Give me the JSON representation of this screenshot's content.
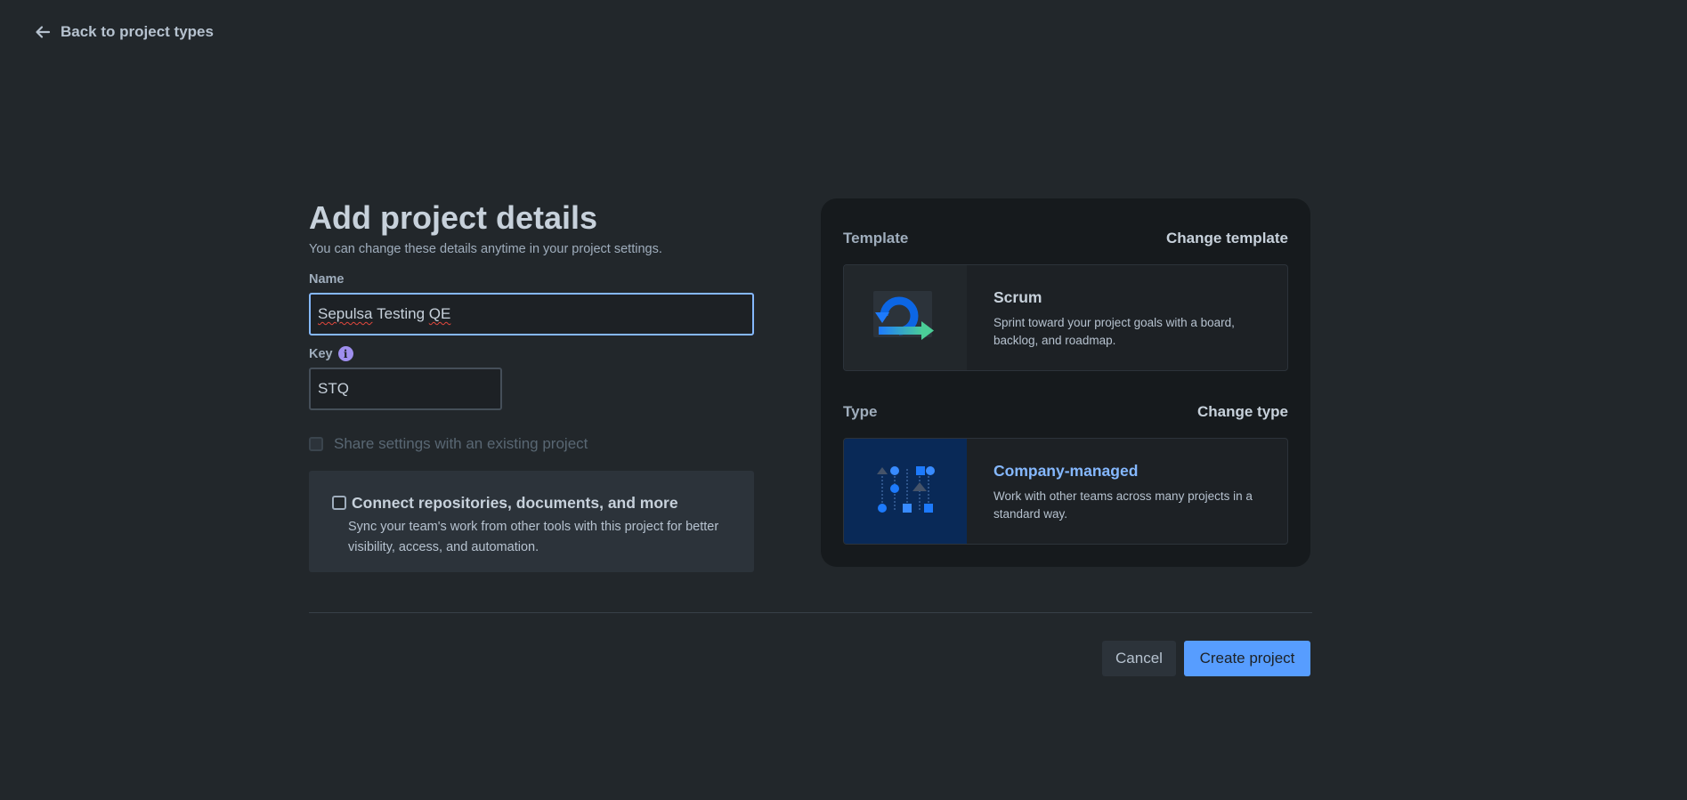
{
  "nav": {
    "back_label": "Back to project types"
  },
  "form": {
    "title": "Add project details",
    "subtitle": "You can change these details anytime in your project settings.",
    "name_label": "Name",
    "name_value_word1": "Sepulsa",
    "name_value_word2": "Testing",
    "name_value_word3": "QE",
    "key_label": "Key",
    "key_info_icon": "i",
    "key_value": "STQ",
    "share_settings_label": "Share settings with an existing project",
    "connect": {
      "title": "Connect repositories, documents, and more",
      "description": "Sync your team's work from other tools with this project for better visibility, access, and automation."
    }
  },
  "side_panel": {
    "template": {
      "heading": "Template",
      "change_label": "Change template",
      "card_title": "Scrum",
      "card_description": "Sprint toward your project goals with a board, backlog, and roadmap.",
      "icon": "scrum-cycle-icon"
    },
    "type": {
      "heading": "Type",
      "change_label": "Change type",
      "card_title": "Company-managed",
      "card_description": "Work with other teams across many projects in a standard way.",
      "icon": "company-managed-icon"
    }
  },
  "actions": {
    "cancel_label": "Cancel",
    "create_label": "Create project"
  },
  "colors": {
    "background": "#22272b",
    "panel": "#161a1d",
    "primary": "#579dff",
    "focus_border": "#85b8ff",
    "link": "#85b8ff"
  }
}
